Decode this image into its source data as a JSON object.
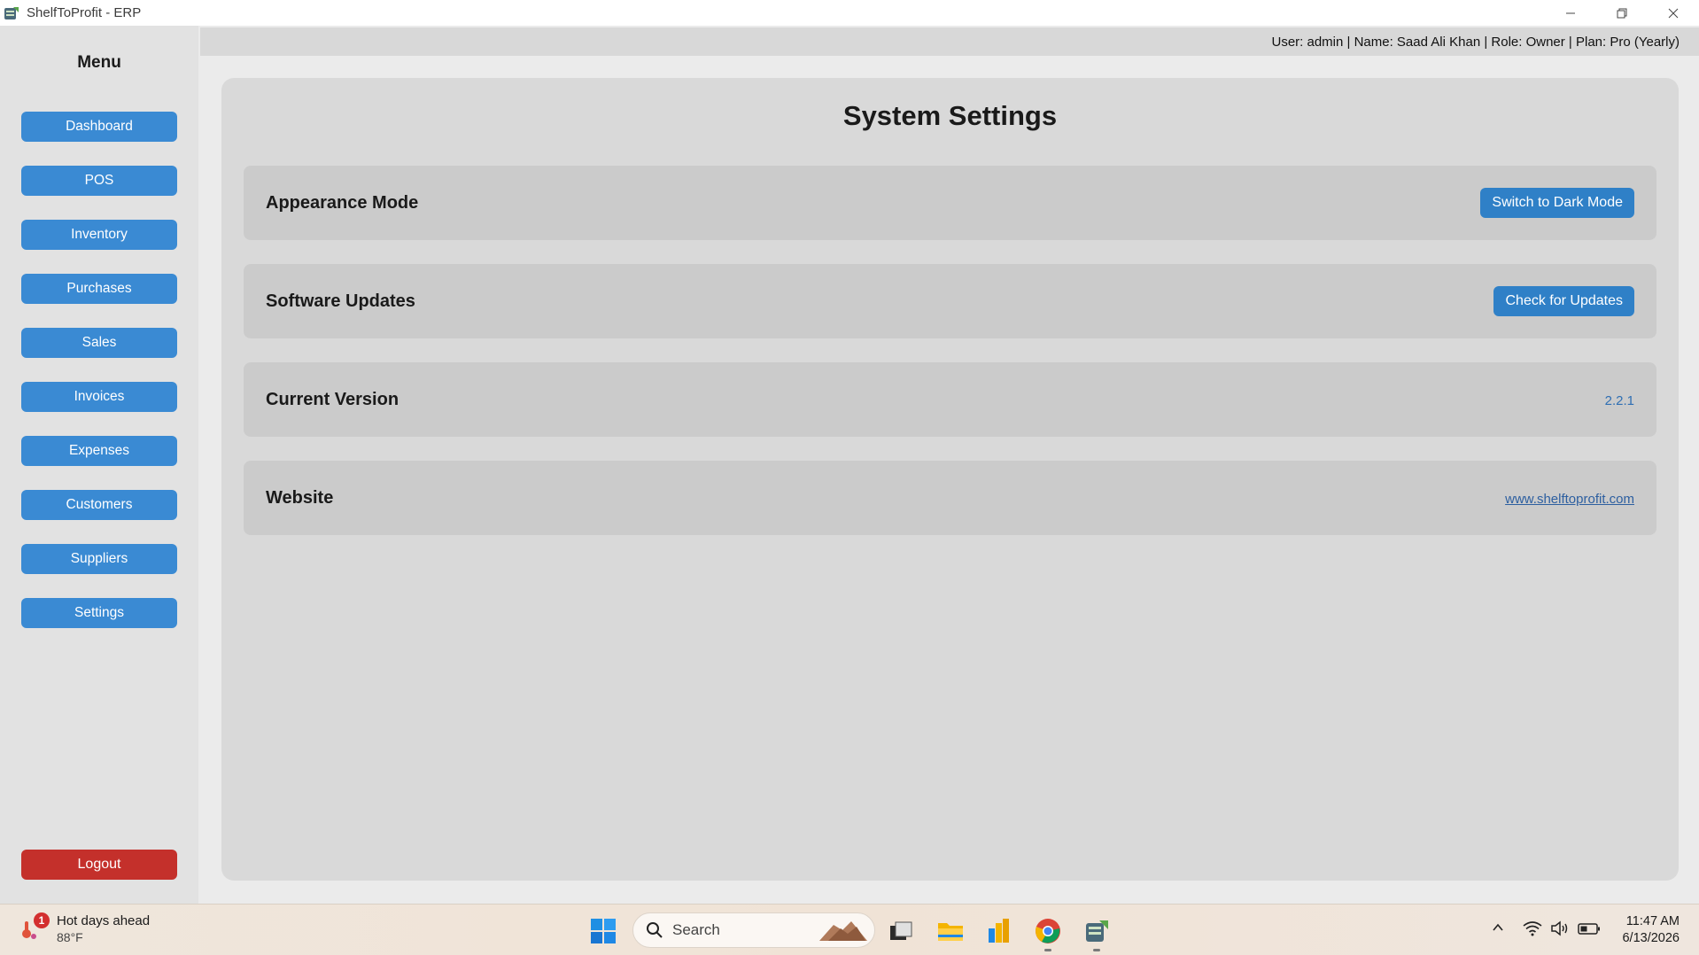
{
  "window": {
    "title": "ShelfToProfit - ERP"
  },
  "sidebar": {
    "menu_title": "Menu",
    "items": [
      {
        "label": "Dashboard"
      },
      {
        "label": "POS"
      },
      {
        "label": "Inventory"
      },
      {
        "label": "Purchases"
      },
      {
        "label": "Sales"
      },
      {
        "label": "Invoices"
      },
      {
        "label": "Expenses"
      },
      {
        "label": "Customers"
      },
      {
        "label": "Suppliers"
      },
      {
        "label": "Settings"
      }
    ],
    "logout_label": "Logout"
  },
  "header": {
    "user_info": "User: admin | Name: Saad Ali Khan | Role: Owner | Plan: Pro (Yearly)"
  },
  "main": {
    "title": "System Settings",
    "rows": [
      {
        "label": "Appearance Mode",
        "button": "Switch to Dark Mode"
      },
      {
        "label": "Software Updates",
        "button": "Check for Updates"
      },
      {
        "label": "Current Version",
        "value": "2.2.1"
      },
      {
        "label": "Website",
        "link": "www.shelftoprofit.com"
      }
    ]
  },
  "taskbar": {
    "weather": {
      "badge": "1",
      "title": "Hot days ahead",
      "temp": "88°F"
    },
    "search_placeholder": "Search",
    "clock": {
      "time": "11:47 AM",
      "date": "6/13/2026"
    }
  },
  "colors": {
    "nav_button": "#3a8ad3",
    "action_button": "#2f80c7",
    "logout_button": "#c4302b"
  }
}
